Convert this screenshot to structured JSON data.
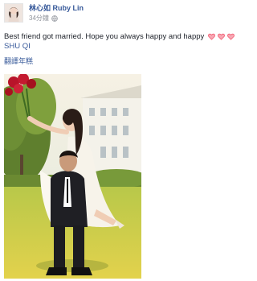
{
  "post": {
    "author_name": "林心如 Ruby Lin",
    "timestamp": "34分鐘",
    "caption": "Best friend got married. Hope you always happy and happy",
    "hearts": [
      "heart-icon",
      "heart-icon",
      "heart-icon"
    ],
    "mention": "SHU QI",
    "translate_label": "翻譯年糕",
    "colors": {
      "link": "#365899",
      "text": "#1d2129",
      "meta": "#90949c",
      "heart": "#f25268"
    }
  }
}
